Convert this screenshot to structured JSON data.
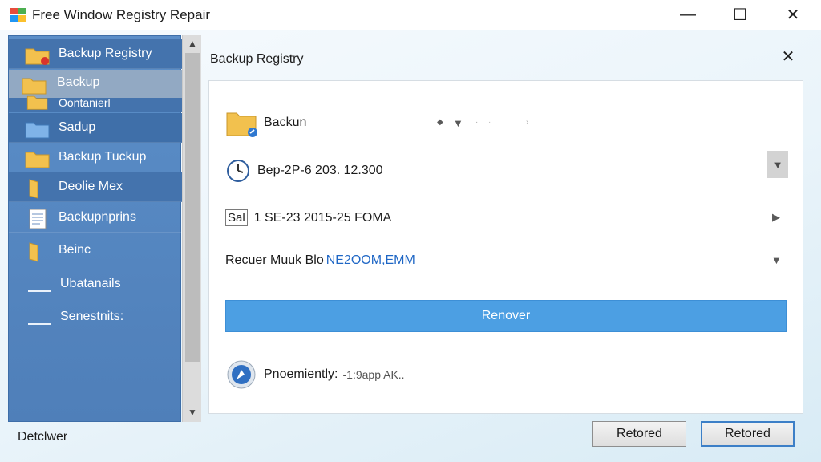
{
  "window": {
    "title": "Free Window Registry Repair",
    "minimize_symbol": "—",
    "maximize_symbol": "☐",
    "close_symbol": "✕"
  },
  "sidebar": {
    "items": [
      {
        "label": "Backup Registry",
        "icon": "folder-restore-icon"
      },
      {
        "label": "Backup",
        "icon": "folder-icon"
      },
      {
        "label": "Oontanierl",
        "icon": "folder-icon"
      },
      {
        "label": "Sadup",
        "icon": "folder-blue-icon"
      },
      {
        "label": "Backup Tuckup",
        "icon": "folder-icon"
      },
      {
        "label": "Deolie Mex",
        "icon": "folder-open-icon"
      },
      {
        "label": "Backupnprins",
        "icon": "document-icon"
      },
      {
        "label": "Beinc",
        "icon": "folder-open-icon"
      },
      {
        "label": "Ubatanails",
        "icon": "line-icon"
      },
      {
        "label": "Senestnits:",
        "icon": "line-icon"
      }
    ]
  },
  "panel": {
    "title": "Backup Registry",
    "close_symbol": "✕",
    "rows": [
      {
        "label": "Backun",
        "icon": "folder-arrow-icon"
      },
      {
        "label": "Bep-2P-6 203. 12.300",
        "icon": "clock-icon"
      },
      {
        "label": "1 SE-23 2015-25 FOMA",
        "icon_text": "Sal"
      },
      {
        "label": "Recuer Muuk Blo",
        "link": "NE2OOM,EMM"
      }
    ],
    "recover_button": "Renover",
    "status": {
      "label": "Pnoemiently:",
      "value": "-1:9app AK.."
    }
  },
  "footer": {
    "status_text": "Detclwer",
    "button_left": "Retored",
    "button_right": "Retored"
  },
  "colors": {
    "sidebar": "#5b8ec8",
    "recover_button": "#4c9fe3",
    "selected_item": "#92a9c3"
  }
}
